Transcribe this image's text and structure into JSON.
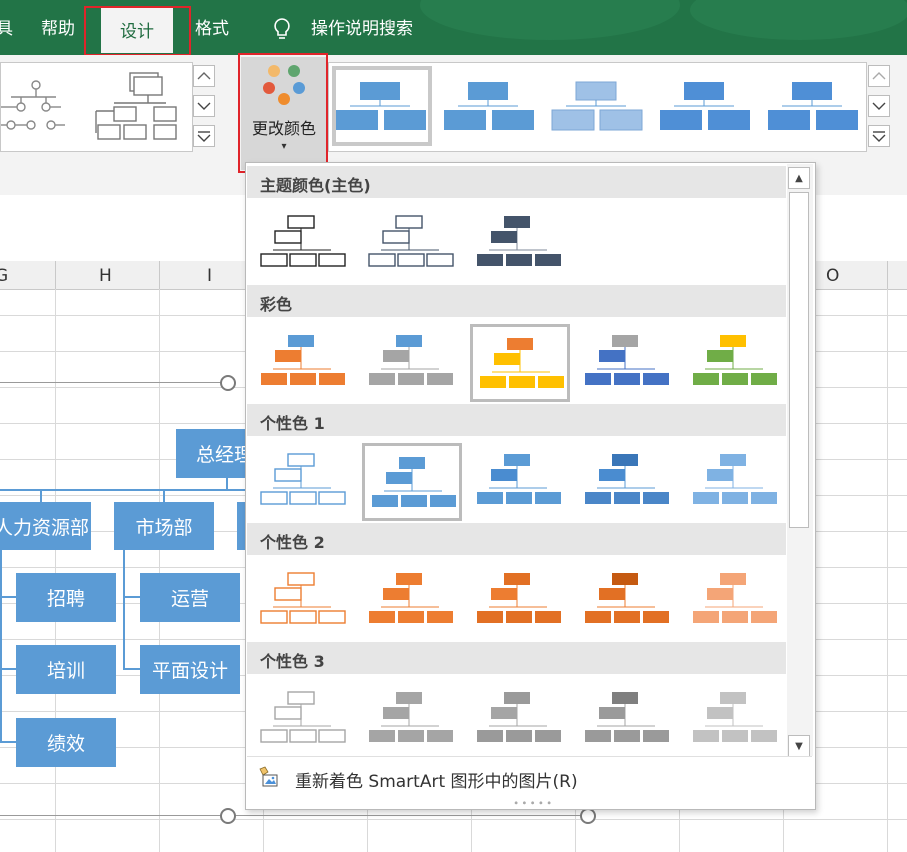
{
  "tabs": {
    "cut_left": "具",
    "help": "帮助",
    "design": "设计",
    "format": "格式",
    "tell_me": "操作说明搜索"
  },
  "ribbon": {
    "change_colors_label": "更改颜色",
    "change_colors_arrow": "▾",
    "dots": [
      "#f3b96a",
      "#5fa56e",
      "#e25a3d",
      "#5a9bd6",
      "#ef8c2d"
    ]
  },
  "columns": [
    "G",
    "H",
    "I",
    "O"
  ],
  "org_chart": {
    "top": "总经理",
    "level2": [
      "人力资源部",
      "市场部"
    ],
    "hr_children": [
      "招聘",
      "培训",
      "绩效"
    ],
    "market_children": [
      "运营",
      "平面设计"
    ],
    "color": "#5b9bd5"
  },
  "dropdown": {
    "sections": [
      "主题颜色(主色)",
      "彩色",
      "个性色 1",
      "个性色 2",
      "个性色 3"
    ],
    "recolor_label": "重新着色 SmartArt 图形中的图片(R)",
    "grip": "∙∙∙∙∙",
    "scroll_up": "▲",
    "scroll_down": "▼"
  },
  "palettes": {
    "colorful": [
      [
        "#5b9bd5",
        "#ed7d31",
        "#ed7d31"
      ],
      [
        "#5b9bd5",
        "#a5a5a5",
        "#a5a5a5"
      ],
      [
        "#ed7d31",
        "#ffc000",
        "#ffc000"
      ],
      [
        "#a5a5a5",
        "#4472c4",
        "#4472c4"
      ],
      [
        "#ffc000",
        "#70ad47",
        "#70ad47"
      ]
    ],
    "accent1": [
      "#5b9bd5",
      "#5b9bd5",
      "#4a8cd0",
      "#7fb2e3"
    ],
    "accent2": [
      "#ed7d31",
      "#e27024",
      "#c55a11",
      "#f4a577"
    ],
    "accent3": [
      "#a5a5a5",
      "#9a9a9a",
      "#7f7f7f",
      "#c2c2c2"
    ],
    "theme_main": [
      "#222222",
      "#44546a",
      "#44546a"
    ]
  }
}
